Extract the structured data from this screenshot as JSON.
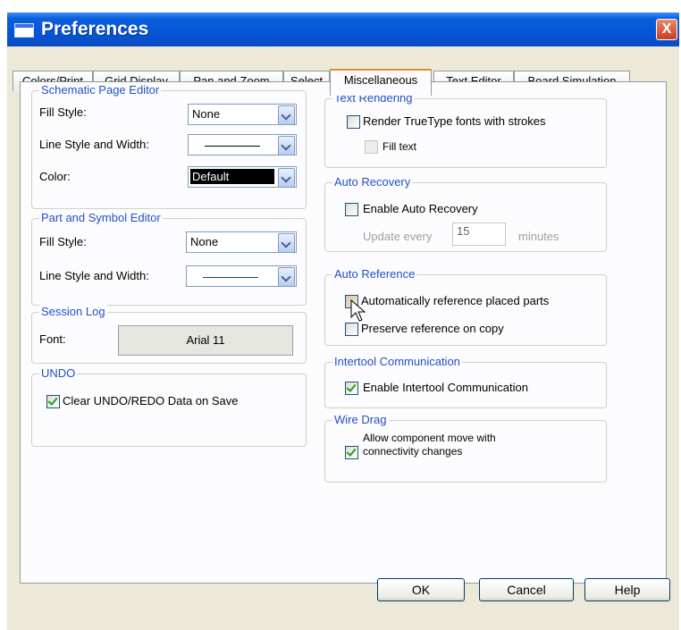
{
  "window": {
    "title": "Preferences",
    "close_glyph": "X"
  },
  "tabs": [
    "Colors/Print",
    "Grid Display",
    "Pan and Zoom",
    "Select",
    "Miscellaneous",
    "Text Editor",
    "Board Simulation"
  ],
  "active_tab": "Miscellaneous",
  "schematic_page_editor": {
    "legend": "Schematic Page Editor",
    "fill_style_label": "Fill Style:",
    "fill_style_value": "None",
    "line_style_label": "Line Style and Width:",
    "color_label": "Color:",
    "color_value": "Default"
  },
  "part_symbol_editor": {
    "legend": "Part and Symbol Editor",
    "fill_style_label": "Fill Style:",
    "fill_style_value": "None",
    "line_style_label": "Line Style and Width:"
  },
  "session_log": {
    "legend": "Session Log",
    "font_label": "Font:",
    "font_value": "Arial 11"
  },
  "undo": {
    "legend": "UNDO",
    "clear_label": "Clear UNDO/REDO Data on Save",
    "clear_checked": true
  },
  "text_rendering": {
    "legend": "Text Rendering",
    "render_label": "Render TrueType fonts with strokes",
    "render_checked": false,
    "fill_label": "Fill text",
    "fill_checked": false
  },
  "auto_recovery": {
    "legend": "Auto Recovery",
    "enable_label": "Enable Auto Recovery",
    "enable_checked": false,
    "update_prefix": "Update every",
    "update_value": "15",
    "update_suffix": "minutes"
  },
  "auto_reference": {
    "legend": "Auto Reference",
    "auto_label": "Automatically reference placed parts",
    "auto_checked": false,
    "preserve_label": "Preserve reference on copy",
    "preserve_checked": false
  },
  "intertool": {
    "legend": "Intertool Communication",
    "enable_label": "Enable Intertool Communication",
    "enable_checked": true
  },
  "wire_drag": {
    "legend": "Wire Drag",
    "allow_label_line1": "Allow component move with",
    "allow_label_line2": "connectivity changes",
    "allow_checked": true
  },
  "buttons": {
    "ok": "OK",
    "cancel": "Cancel",
    "help": "Help"
  },
  "colors": {
    "titlebar": "#0455d6",
    "dialog_bg": "#ece9d8",
    "legend_text": "#2350c8"
  },
  "icons": [
    "window-icon",
    "close-icon",
    "chevron-down-icon",
    "checkmark-icon",
    "mouse-cursor-icon"
  ]
}
